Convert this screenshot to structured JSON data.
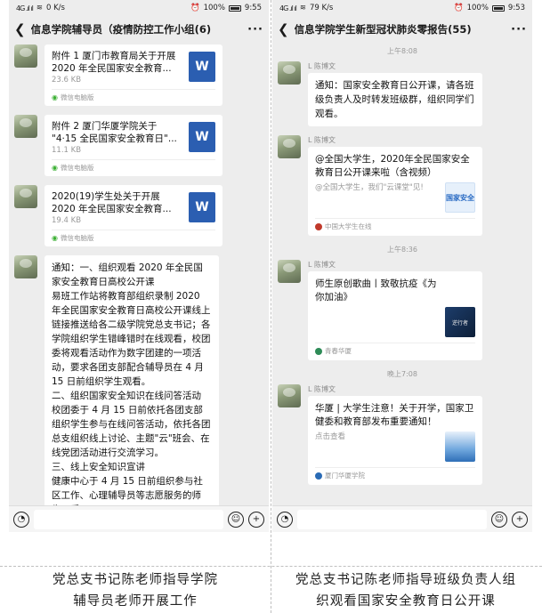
{
  "left_phone": {
    "status": {
      "network": "4G",
      "signal": "4G .ıl ıl",
      "speed": "0",
      "speed_unit": "K/s",
      "battery": "100%",
      "time": "9:55"
    },
    "title": "信息学院辅导员（疫情防控工作小组(6)",
    "messages": [
      {
        "type": "file",
        "title": "附件 1 厦门市教育局关于开展 2020 年全民国家安全教育...",
        "size": "23.6 KB",
        "source": "微信电脑版"
      },
      {
        "type": "file",
        "title": "附件 2 厦门华厦学院关于 \"4·15 全民国家安全教育日\"...",
        "size": "11.1 KB",
        "source": "微信电脑版"
      },
      {
        "type": "file",
        "title": "2020(19)学生处关于开展 2020 年全民国家安全教育...",
        "size": "19.4 KB",
        "source": "微信电脑版"
      },
      {
        "type": "text",
        "paragraphs": [
          "通知：一、组织观看 2020 年全民国家安全教育日高校公开课",
          "易班工作站将教育部组织录制 2020 年全民国家安全教育日高校公开课线上链接推送给各二级学院党总支书记；各学院组织学生错峰错时在线观看，校团委将观看活动作为数字团建的一项活动，要求各团支部配合辅导员在 4 月 15 日前组织学生观看。",
          "二、组织国家安全知识在线问答活动",
          "校团委于 4 月 15 日前依托各团支部组织学生参与在线问答活动，依托各团总支组织线上讨论、主题\"云\"班会、在线党团活动进行交流学习。",
          "三、线上安全知识宣讲",
          "健康中心于 4 月 15 日前组织参与社区工作、心理辅导员等志愿服务的师生，采"
        ]
      }
    ]
  },
  "right_phone": {
    "status": {
      "network": "4G",
      "signal": "4G .ıl ıl",
      "speed": "79",
      "speed_unit": "K/s",
      "battery": "100%",
      "time": "9:53"
    },
    "title": "信息学院学生新型冠状肺炎零报告(55)",
    "times": [
      "上午8:08",
      "上午8:36",
      "晚上7:08"
    ],
    "sender": "L 陈博文",
    "messages": [
      {
        "type": "text",
        "text": "通知：国家安全教育日公开课，请各班级负责人及时转发班级群，组织同学们观看。"
      },
      {
        "type": "link",
        "title": "@全国大学生，2020年全民国家安全教育日公开课来啦（含视频）",
        "desc": "@全国大学生，我们\"云课堂\"见!",
        "source": "中国大学生在线",
        "thumb_text": "国家安全"
      },
      {
        "type": "link",
        "title": "师生原创歌曲丨致敬抗疫《为你加油》",
        "desc": "",
        "source": "青春华厦",
        "thumb_text": "逆行者"
      },
      {
        "type": "link",
        "title": "华厦 | 大学生注意！关于开学，国家卫健委和教育部发布重要通知！",
        "desc": "点击查看",
        "source": "厦门华厦学院",
        "thumb_text": ""
      }
    ]
  },
  "captions": {
    "left": [
      "党总支书记陈老师指导学院",
      "辅导员老师开展工作"
    ],
    "right": [
      "党总支书记陈老师指导班级负责人组",
      "织观看国家安全教育日公开课"
    ]
  },
  "icons": {
    "back": "chevron-left-icon",
    "more": "more-dots-icon",
    "voice": "voice-icon",
    "emoji": "emoji-icon",
    "plus": "plus-icon",
    "file": "word-file-icon"
  },
  "colors": {
    "chat_bg": "#ededed",
    "word_blue": "#2b5eb1",
    "wechat_green": "#3cb034"
  }
}
